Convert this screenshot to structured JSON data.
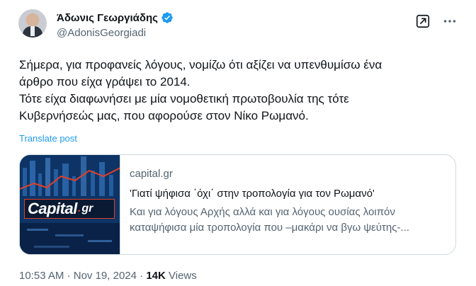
{
  "author": {
    "display_name": "Άδωνις Γεωργιάδης",
    "handle": "@AdonisGeorgiadi",
    "verified": true,
    "verified_color": "#1d9bf0"
  },
  "header_icons": [
    "xai-grok-icon",
    "more-options-icon"
  ],
  "tweet": {
    "lines": [
      "Σήμερα, για προφανείς λόγους, νομίζω ότι αξίζει να υπενθυμίσω ένα",
      "άρθρο που είχα γράψει το 2014.",
      "Τότε είχα διαφωνήσει με μία νομοθετική πρωτοβουλία της τότε",
      "Κυβερνήσεώς μας, που αφορούσε στον Νίκο Ρωμανό."
    ],
    "translate_label": "Translate post"
  },
  "link_card": {
    "domain": "capital.gr",
    "title": "'Γιατί ψήφισα ΄όχι΄ στην τροπολογία για τον Ρωμανό'",
    "description_lines": [
      "Και για λόγους Αρχής αλλά και για λόγους ουσίας λοιπόν",
      "καταψήφισα μία τροπολογία που –μακάρι να βγω ψεύτης-..."
    ],
    "thumbnail": {
      "logo_main": "Capital",
      "logo_dot": ".",
      "logo_suffix": "gr"
    }
  },
  "meta": {
    "time": "10:53 AM",
    "separator": "·",
    "date": "Nov 19, 2024",
    "views_count": "14K",
    "views_label": "Views"
  }
}
